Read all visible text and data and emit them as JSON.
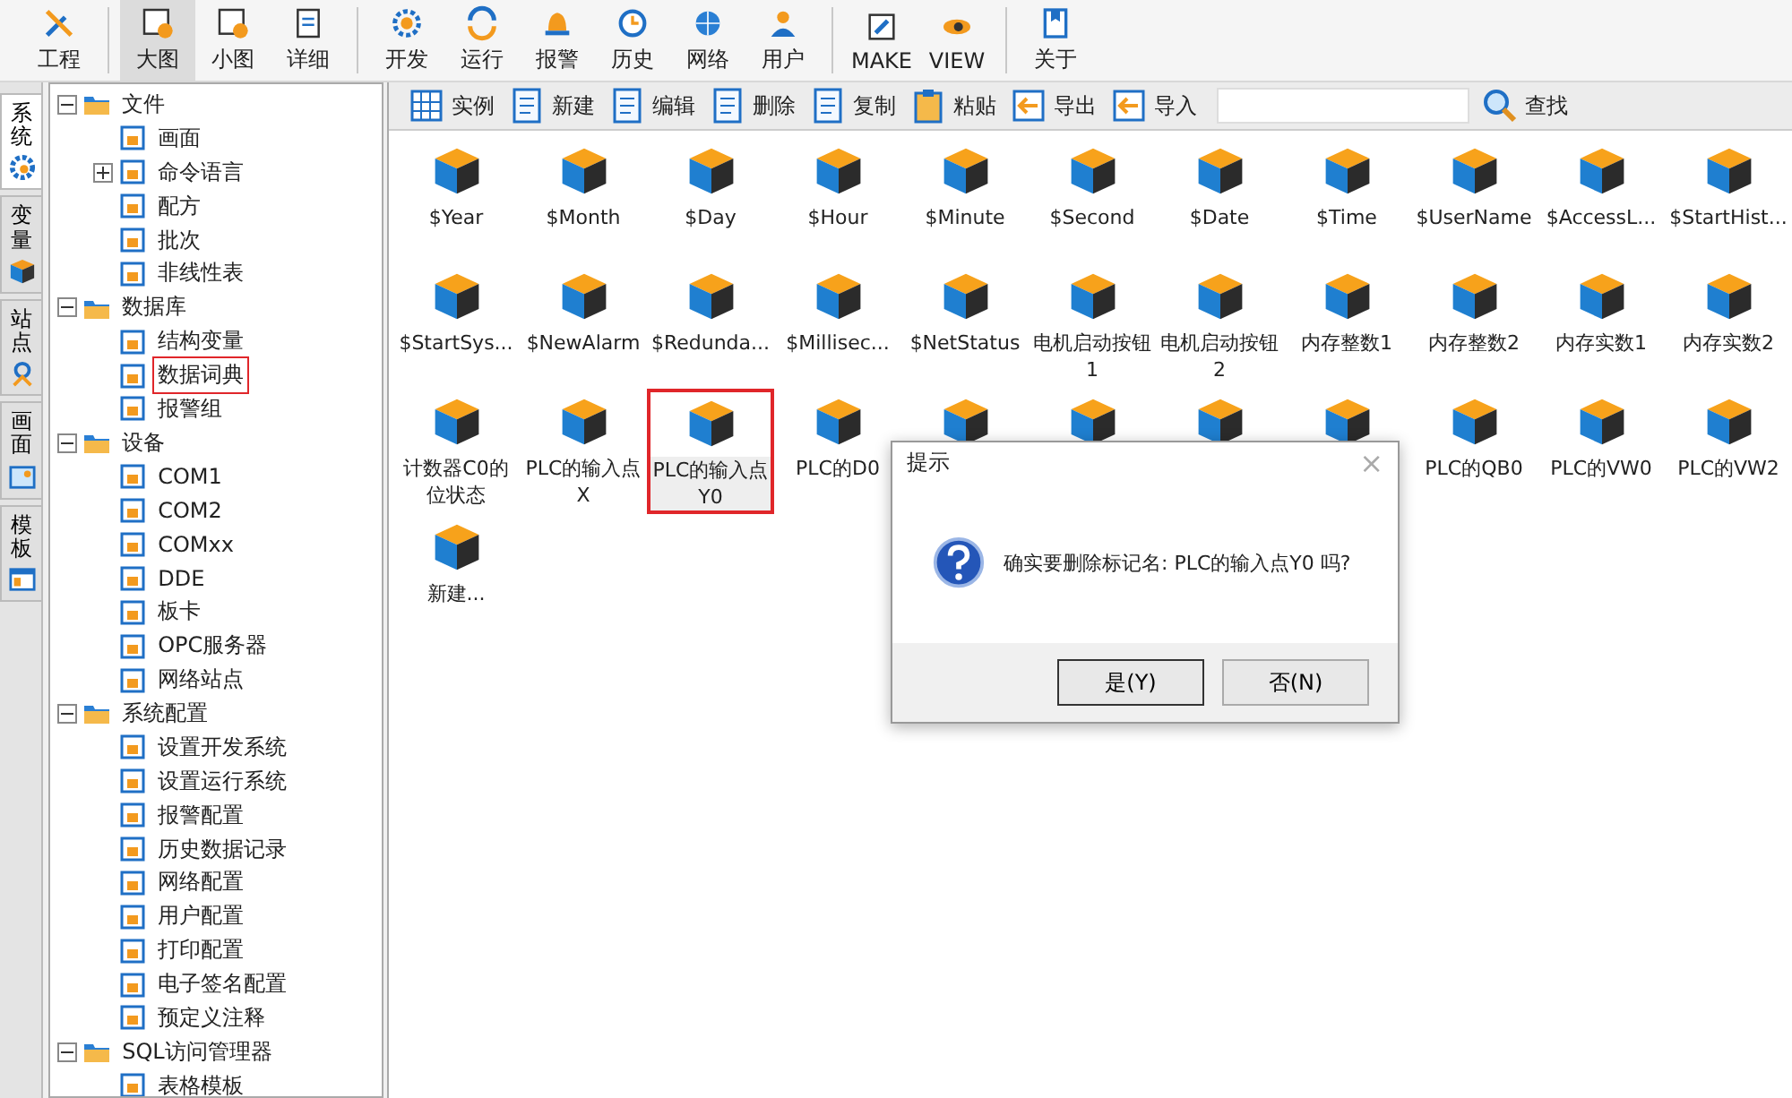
{
  "toolbar": {
    "groups": [
      [
        {
          "label": "工程",
          "selected": false
        }
      ],
      [
        {
          "label": "大图",
          "selected": true
        },
        {
          "label": "小图",
          "selected": false
        },
        {
          "label": "详细",
          "selected": false
        }
      ],
      [
        {
          "label": "开发",
          "selected": false
        },
        {
          "label": "运行",
          "selected": false
        },
        {
          "label": "报警",
          "selected": false
        },
        {
          "label": "历史",
          "selected": false
        },
        {
          "label": "网络",
          "selected": false
        },
        {
          "label": "用户",
          "selected": false
        }
      ],
      [
        {
          "label": "MAKE",
          "selected": false
        },
        {
          "label": "VIEW",
          "selected": false
        }
      ],
      [
        {
          "label": "关于",
          "selected": false
        }
      ]
    ]
  },
  "side_tabs": [
    {
      "label": "系统",
      "selected": true
    },
    {
      "label": "变量",
      "selected": false
    },
    {
      "label": "站点",
      "selected": false
    },
    {
      "label": "画面",
      "selected": false
    },
    {
      "label": "模板",
      "selected": false
    }
  ],
  "tree": [
    {
      "label": "文件",
      "expanded": true,
      "children": [
        {
          "label": "画面"
        },
        {
          "label": "命令语言",
          "expanded": false
        },
        {
          "label": "配方"
        },
        {
          "label": "批次"
        },
        {
          "label": "非线性表"
        }
      ]
    },
    {
      "label": "数据库",
      "expanded": true,
      "children": [
        {
          "label": "结构变量"
        },
        {
          "label": "数据词典",
          "selected": true
        },
        {
          "label": "报警组"
        }
      ]
    },
    {
      "label": "设备",
      "expanded": true,
      "children": [
        {
          "label": "COM1"
        },
        {
          "label": "COM2"
        },
        {
          "label": "COMxx"
        },
        {
          "label": "DDE"
        },
        {
          "label": "板卡"
        },
        {
          "label": "OPC服务器"
        },
        {
          "label": "网络站点"
        }
      ]
    },
    {
      "label": "系统配置",
      "expanded": true,
      "children": [
        {
          "label": "设置开发系统"
        },
        {
          "label": "设置运行系统"
        },
        {
          "label": "报警配置"
        },
        {
          "label": "历史数据记录"
        },
        {
          "label": "网络配置"
        },
        {
          "label": "用户配置"
        },
        {
          "label": "打印配置"
        },
        {
          "label": "电子签名配置"
        },
        {
          "label": "预定义注释"
        }
      ]
    },
    {
      "label": "SQL访问管理器",
      "expanded": true,
      "children": [
        {
          "label": "表格模板"
        }
      ]
    }
  ],
  "actions": [
    "实例",
    "新建",
    "编辑",
    "删除",
    "复制",
    "粘贴",
    "导出",
    "导入"
  ],
  "search": {
    "button": "查找"
  },
  "items": [
    {
      "label": "$Year",
      "selected": false
    },
    {
      "label": "$Month",
      "selected": false
    },
    {
      "label": "$Day",
      "selected": false
    },
    {
      "label": "$Hour",
      "selected": false
    },
    {
      "label": "$Minute",
      "selected": false
    },
    {
      "label": "$Second",
      "selected": false
    },
    {
      "label": "$Date",
      "selected": false
    },
    {
      "label": "$Time",
      "selected": false
    },
    {
      "label": "$UserName",
      "selected": false
    },
    {
      "label": "$AccessL...",
      "selected": false
    },
    {
      "label": "$StartHist...",
      "selected": false
    },
    {
      "label": "$StartSys...",
      "selected": false
    },
    {
      "label": "$NewAlarm",
      "selected": false
    },
    {
      "label": "$Redunda...",
      "selected": false
    },
    {
      "label": "$Millisec...",
      "selected": false
    },
    {
      "label": "$NetStatus",
      "selected": false
    },
    {
      "label": "电机启动按钮1",
      "selected": false
    },
    {
      "label": "电机启动按钮2",
      "selected": false
    },
    {
      "label": "内存整数1",
      "selected": false
    },
    {
      "label": "内存整数2",
      "selected": false
    },
    {
      "label": "内存实数1",
      "selected": false
    },
    {
      "label": "内存实数2",
      "selected": false
    },
    {
      "label": "计数器C0的位状态",
      "selected": false
    },
    {
      "label": "PLC的输入点X",
      "selected": false
    },
    {
      "label": "PLC的输入点Y0",
      "selected": true
    },
    {
      "label": "PLC的D0",
      "selected": false
    },
    {
      "selected": false
    },
    {
      "selected": false
    },
    {
      "selected": false
    },
    {
      "selected": false
    },
    {
      "label": "PLC的QB0",
      "selected": false
    },
    {
      "label": "PLC的VW0",
      "selected": false
    },
    {
      "label": "PLC的VW2",
      "selected": false
    },
    {
      "label": "新建...",
      "selected": false
    }
  ],
  "dialog": {
    "title": "提示",
    "close": "×",
    "message": "确实要删除标记名: PLC的输入点Y0 吗?",
    "buttons": [
      "是(Y)",
      "否(N)"
    ]
  }
}
